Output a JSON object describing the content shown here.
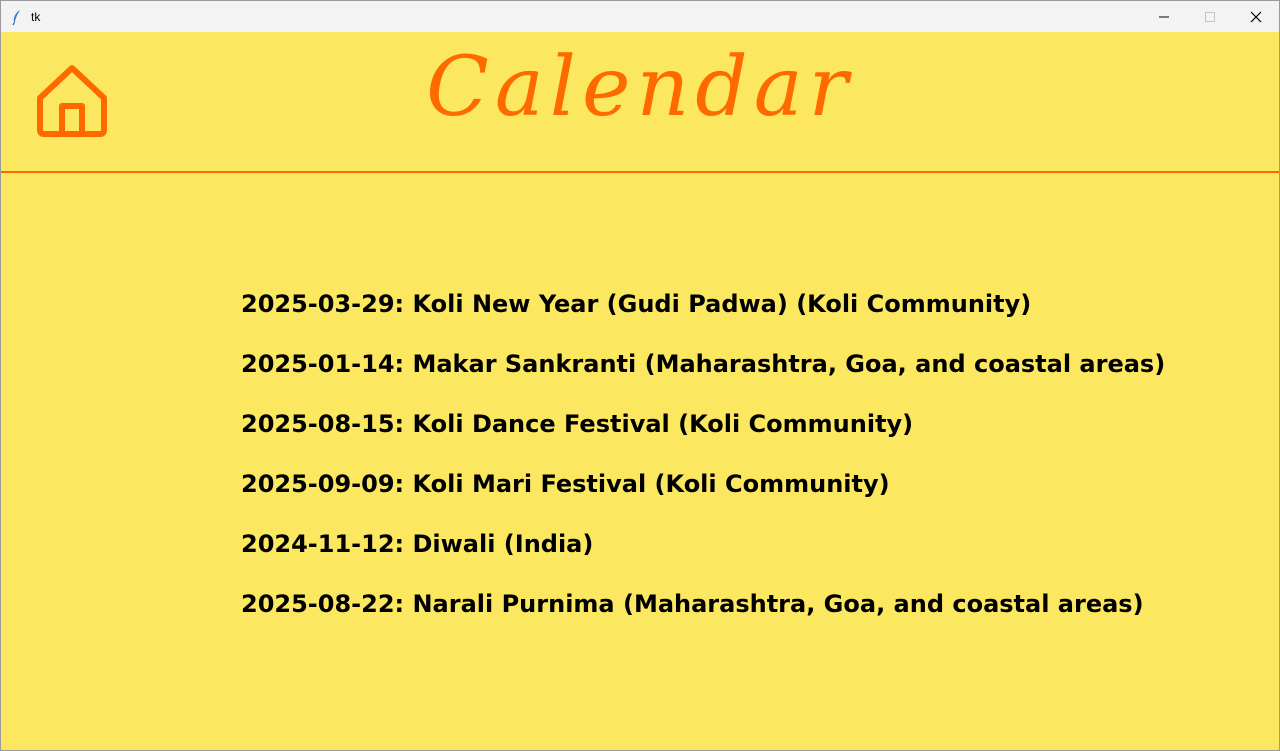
{
  "window": {
    "title": "tk"
  },
  "header": {
    "title": "Calendar"
  },
  "events": [
    "2025-03-29: Koli New Year (Gudi Padwa) (Koli Community)",
    "2025-01-14: Makar Sankranti (Maharashtra, Goa, and coastal areas)",
    "2025-08-15: Koli Dance Festival (Koli Community)",
    "2025-09-09: Koli Mari Festival (Koli Community)",
    "2024-11-12: Diwali (India)",
    "2025-08-22: Narali Purnima (Maharashtra, Goa, and coastal areas)"
  ],
  "colors": {
    "background": "#fce860",
    "accent": "#ff6a00",
    "text": "#000000"
  },
  "icons": {
    "app": "feather-icon",
    "home": "home-icon",
    "minimize": "minimize-icon",
    "maximize": "maximize-icon",
    "close": "close-icon"
  }
}
